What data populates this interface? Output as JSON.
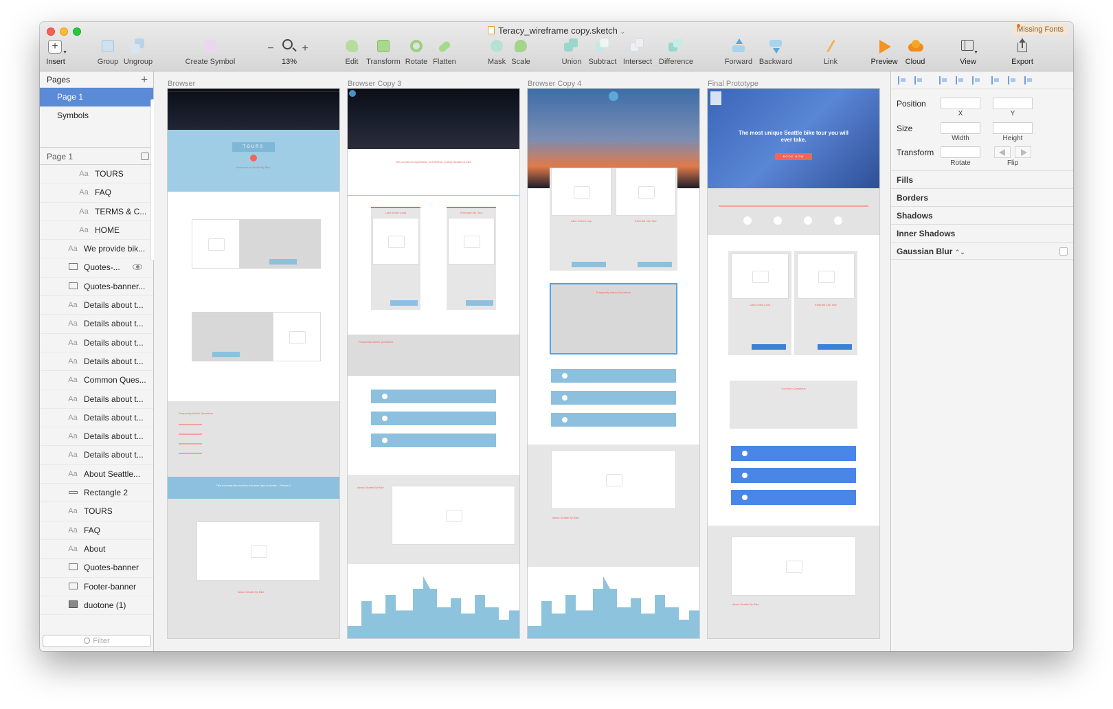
{
  "window": {
    "title": "Teracy_wireframe copy.sketch",
    "missing_fonts": "Missing Fonts"
  },
  "toolbar": {
    "insert": "Insert",
    "group": "Group",
    "ungroup": "Ungroup",
    "create_symbol": "Create Symbol",
    "zoom_out": "−",
    "zoom": "13%",
    "zoom_in": "+",
    "edit": "Edit",
    "transform": "Transform",
    "rotate": "Rotate",
    "flatten": "Flatten",
    "mask": "Mask",
    "scale": "Scale",
    "union": "Union",
    "subtract": "Subtract",
    "intersect": "Intersect",
    "difference": "Difference",
    "forward": "Forward",
    "backward": "Backward",
    "link": "Link",
    "preview": "Preview",
    "cloud": "Cloud",
    "view": "View",
    "export": "Export"
  },
  "sidebar": {
    "pages_title": "Pages",
    "add": "+",
    "pages": [
      "Page 1",
      "Symbols"
    ],
    "layers_title": "Page 1",
    "layers": [
      {
        "icon": "text",
        "label": "TOURS",
        "indent": 2
      },
      {
        "icon": "text",
        "label": "FAQ",
        "indent": 2
      },
      {
        "icon": "text",
        "label": "TERMS & C...",
        "indent": 2
      },
      {
        "icon": "text",
        "label": "HOME",
        "indent": 2
      },
      {
        "icon": "text",
        "label": "We provide bik...",
        "indent": 1
      },
      {
        "icon": "rect",
        "label": "Quotes-...",
        "indent": 1,
        "hidden": true
      },
      {
        "icon": "rect",
        "label": "Quotes-banner...",
        "indent": 1
      },
      {
        "icon": "text",
        "label": "Details about t...",
        "indent": 1
      },
      {
        "icon": "text",
        "label": "Details about t...",
        "indent": 1
      },
      {
        "icon": "text",
        "label": "Details about t...",
        "indent": 1
      },
      {
        "icon": "text",
        "label": "Details about t...",
        "indent": 1
      },
      {
        "icon": "text",
        "label": "Common Ques...",
        "indent": 1
      },
      {
        "icon": "text",
        "label": "Details about t...",
        "indent": 1
      },
      {
        "icon": "text",
        "label": "Details about t...",
        "indent": 1
      },
      {
        "icon": "text",
        "label": "Details about t...",
        "indent": 1
      },
      {
        "icon": "text",
        "label": "Details about t...",
        "indent": 1
      },
      {
        "icon": "text",
        "label": "About Seattle...",
        "indent": 1
      },
      {
        "icon": "line",
        "label": "Rectangle 2",
        "indent": 1
      },
      {
        "icon": "text",
        "label": "TOURS",
        "indent": 1
      },
      {
        "icon": "text",
        "label": "FAQ",
        "indent": 1
      },
      {
        "icon": "text",
        "label": "About",
        "indent": 1
      },
      {
        "icon": "rect",
        "label": "Quotes-banner",
        "indent": 1
      },
      {
        "icon": "rect",
        "label": "Footer-banner",
        "indent": 1
      },
      {
        "icon": "image",
        "label": "duotone (1)",
        "indent": 1
      }
    ],
    "filter_placeholder": "Filter"
  },
  "canvas": {
    "artboards": [
      {
        "title": "Browser",
        "tours_button": "TOURS",
        "welcome": "Welcome to Seattle By Bike",
        "faq_heading": "Frequently Asked Questions",
        "quote": "This tour was the most fun I've ever had on a bike. - Person 2",
        "about": "About Seattle By Bike"
      },
      {
        "title": "Browser Copy 3",
        "tagline": "We provide an experience of a lifetime, touring Seattle by bike",
        "tour1": "Lake Union Loop",
        "tour2": "Emerald City Tour",
        "faq_heading": "Frequently Asked Questions",
        "about": "About Seattle By Bike"
      },
      {
        "title": "Browser Copy 4",
        "tour1": "Lake Union Loop",
        "tour2": "Emerald City Tour",
        "faq_heading": "Frequently Asked Questions",
        "about": "About Seattle By Bike"
      },
      {
        "title": "Final Prototype",
        "hero": "The most unique Seattle bike tour you will ever take.",
        "book_now": "BOOK NOW",
        "tour1": "Lake Union Loop",
        "tour2": "Emerald City Tour",
        "faq_heading": "Common Questions",
        "about": "About Seattle By Bike"
      }
    ]
  },
  "inspector": {
    "position": "Position",
    "x": "X",
    "y": "Y",
    "size": "Size",
    "width": "Width",
    "height": "Height",
    "transform": "Transform",
    "rotate": "Rotate",
    "flip": "Flip",
    "fills": "Fills",
    "borders": "Borders",
    "shadows": "Shadows",
    "inner_shadows": "Inner Shadows",
    "gaussian_blur": "Gaussian Blur"
  },
  "colors": {
    "selection": "#5b8ad6",
    "accent_red": "#f1665a",
    "wire_blue": "#8cc0de",
    "prototype_blue": "#4a86e8"
  }
}
